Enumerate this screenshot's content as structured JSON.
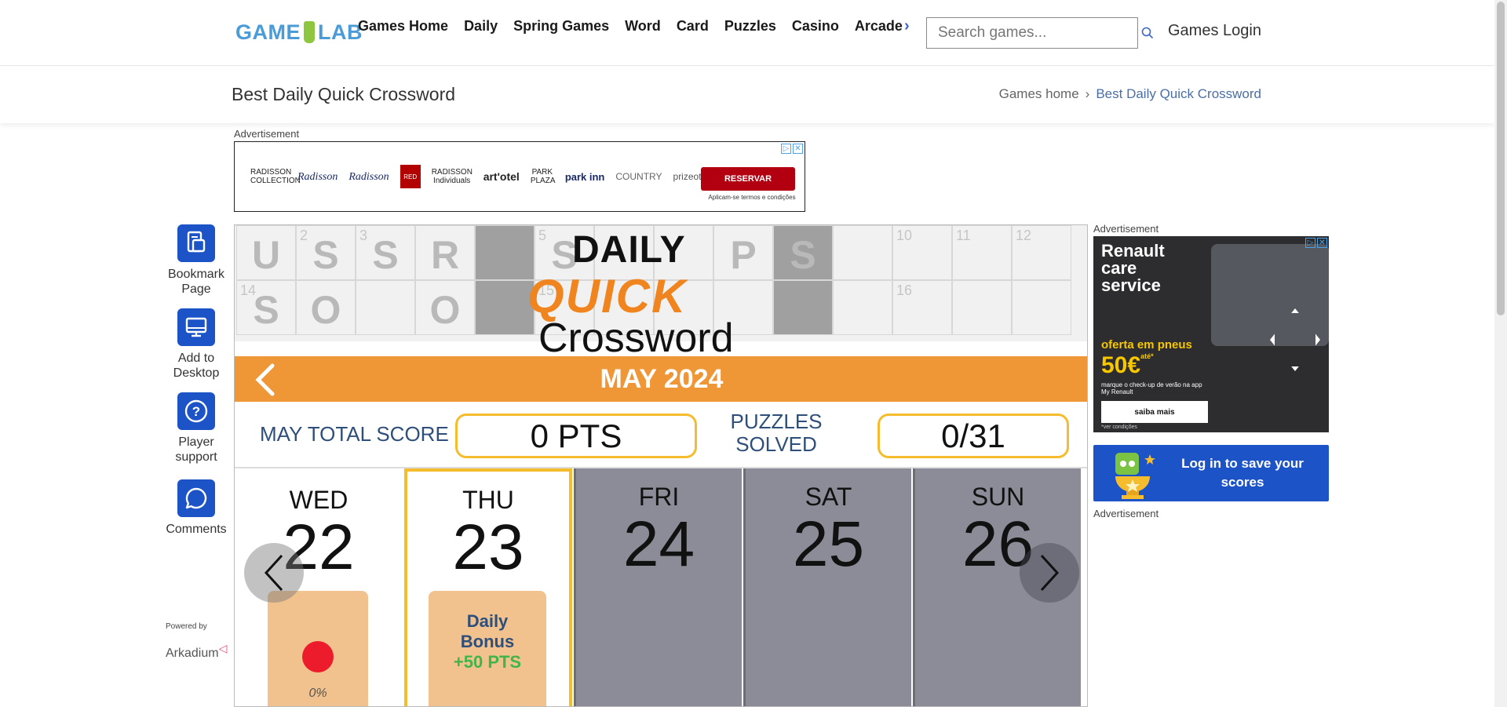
{
  "header": {
    "logo": {
      "left": "GAME",
      "right": "LAB"
    },
    "nav": [
      "Games Home",
      "Daily",
      "Spring Games",
      "Word",
      "Card",
      "Puzzles",
      "Casino",
      "Arcade"
    ],
    "nav_more": "›",
    "search_placeholder": "Search games...",
    "login": "Games Login"
  },
  "titlebar": {
    "title": "Best Daily Quick Crossword",
    "breadcrumb": {
      "home": "Games home",
      "sep": "›",
      "current": "Best Daily Quick Crossword"
    }
  },
  "ads": {
    "label": "Advertisement",
    "banner": {
      "brands": [
        "RADISSON COLLECTION",
        "Radisson",
        "Radisson",
        "RED",
        "RADISSON Individuals",
        "art'otel",
        "PARK PLAZA",
        "park inn",
        "COUNTRY",
        "prizeotel"
      ],
      "button": "RESERVAR",
      "note": "Aplicam-se termos e condições"
    },
    "side": {
      "headline": [
        "Renault",
        "care",
        "service"
      ],
      "offer": "oferta em pneus",
      "amount": "50€",
      "amount_note": "até*",
      "small": "marque o check-up de verão na app My Renault",
      "button": "saiba mais",
      "footnote": "*ver condições"
    }
  },
  "sidebar": [
    {
      "label": "Bookmark Page",
      "icon": "bookmark-page-icon"
    },
    {
      "label": "Add to Desktop",
      "icon": "desktop-icon"
    },
    {
      "label": "Player support",
      "icon": "help-icon"
    },
    {
      "label": "Comments",
      "icon": "comments-icon"
    }
  ],
  "powered": {
    "label": "Powered by",
    "brand": "Arkadium"
  },
  "game": {
    "logo": {
      "line1": "DAILY",
      "line2": "QUICK",
      "line3": "Crossword"
    },
    "grid": {
      "row1": [
        "U",
        "S",
        "S",
        "R",
        "",
        "S",
        "",
        "",
        "P",
        "S",
        "",
        "",
        "",
        ""
      ],
      "row2": [
        "S",
        "O",
        "",
        "O",
        "",
        "",
        "",
        "",
        "",
        "",
        "",
        "",
        "",
        ""
      ],
      "numbers": {
        "r1": [
          "",
          "2",
          "3",
          "",
          "",
          "5",
          "",
          "",
          "",
          "",
          "",
          "10",
          "11",
          "12"
        ],
        "r2": [
          "14",
          "",
          "",
          "",
          "",
          "15",
          "",
          "",
          "",
          "",
          "",
          "16",
          "",
          ""
        ]
      }
    },
    "month": "MAY 2024",
    "score_label": "MAY TOTAL SCORE",
    "score_value": "0 PTS",
    "solved_label": "PUZZLES SOLVED",
    "solved_value": "0/31",
    "days": [
      {
        "name": "WED",
        "num": "22",
        "progress": "0%"
      },
      {
        "name": "THU",
        "num": "23",
        "bonus": "Daily Bonus",
        "bonus_pts": "+50 PTS"
      },
      {
        "name": "FRI",
        "num": "24"
      },
      {
        "name": "SAT",
        "num": "25"
      },
      {
        "name": "SUN",
        "num": "26"
      }
    ]
  },
  "login_box": {
    "text": "Log in to save your scores"
  },
  "colors": {
    "accent_blue": "#1c54c8",
    "orange": "#ef9637",
    "gold": "#f5bd2e",
    "score_text": "#2e4f7a",
    "green": "#3fb54a",
    "red_dot": "#ec1c2c"
  }
}
